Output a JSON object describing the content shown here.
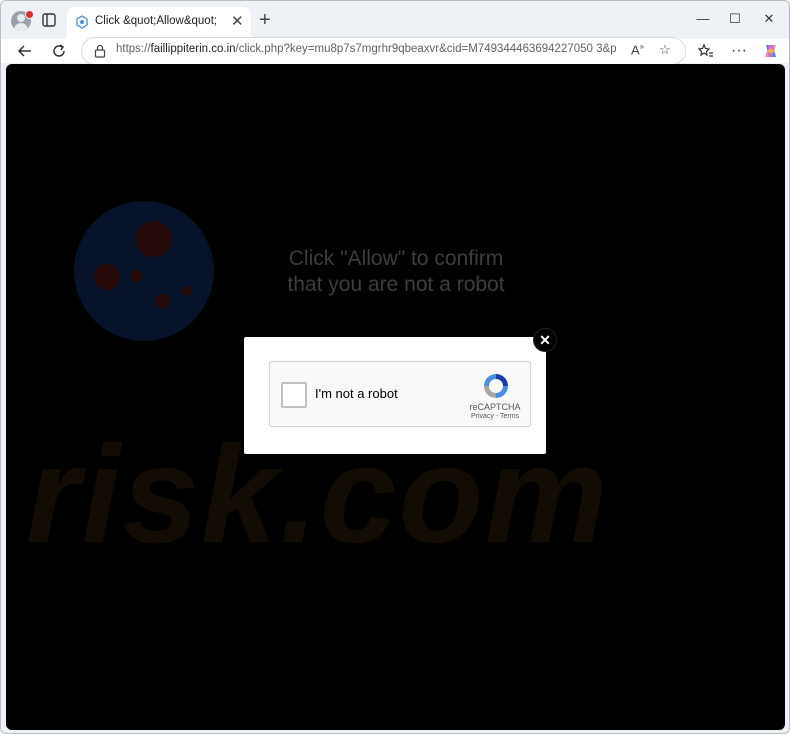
{
  "browser": {
    "tab_title": "Click &quot;Allow&quot;",
    "url_scheme": "https://",
    "url_host": "faillippiterin.co.in",
    "url_path": "/click.php?key=mu8p7s7mgrhr9qbeaxvr&cid=M749344463694227050 3&pad=2...",
    "window_controls": {
      "minimize": "—",
      "maximize": "☐",
      "close": "✕"
    }
  },
  "page": {
    "prompt_text": "Click \"Allow\" to confirm that you are not a robot",
    "watermark": "risk.com",
    "captcha": {
      "label": "I'm not a robot",
      "brand": "reCAPTCHA",
      "links": "Privacy - Terms"
    }
  },
  "colors": {
    "page_background": "#000000",
    "watermark_orange": "#130c04",
    "watermark_blue": "#06132a"
  }
}
